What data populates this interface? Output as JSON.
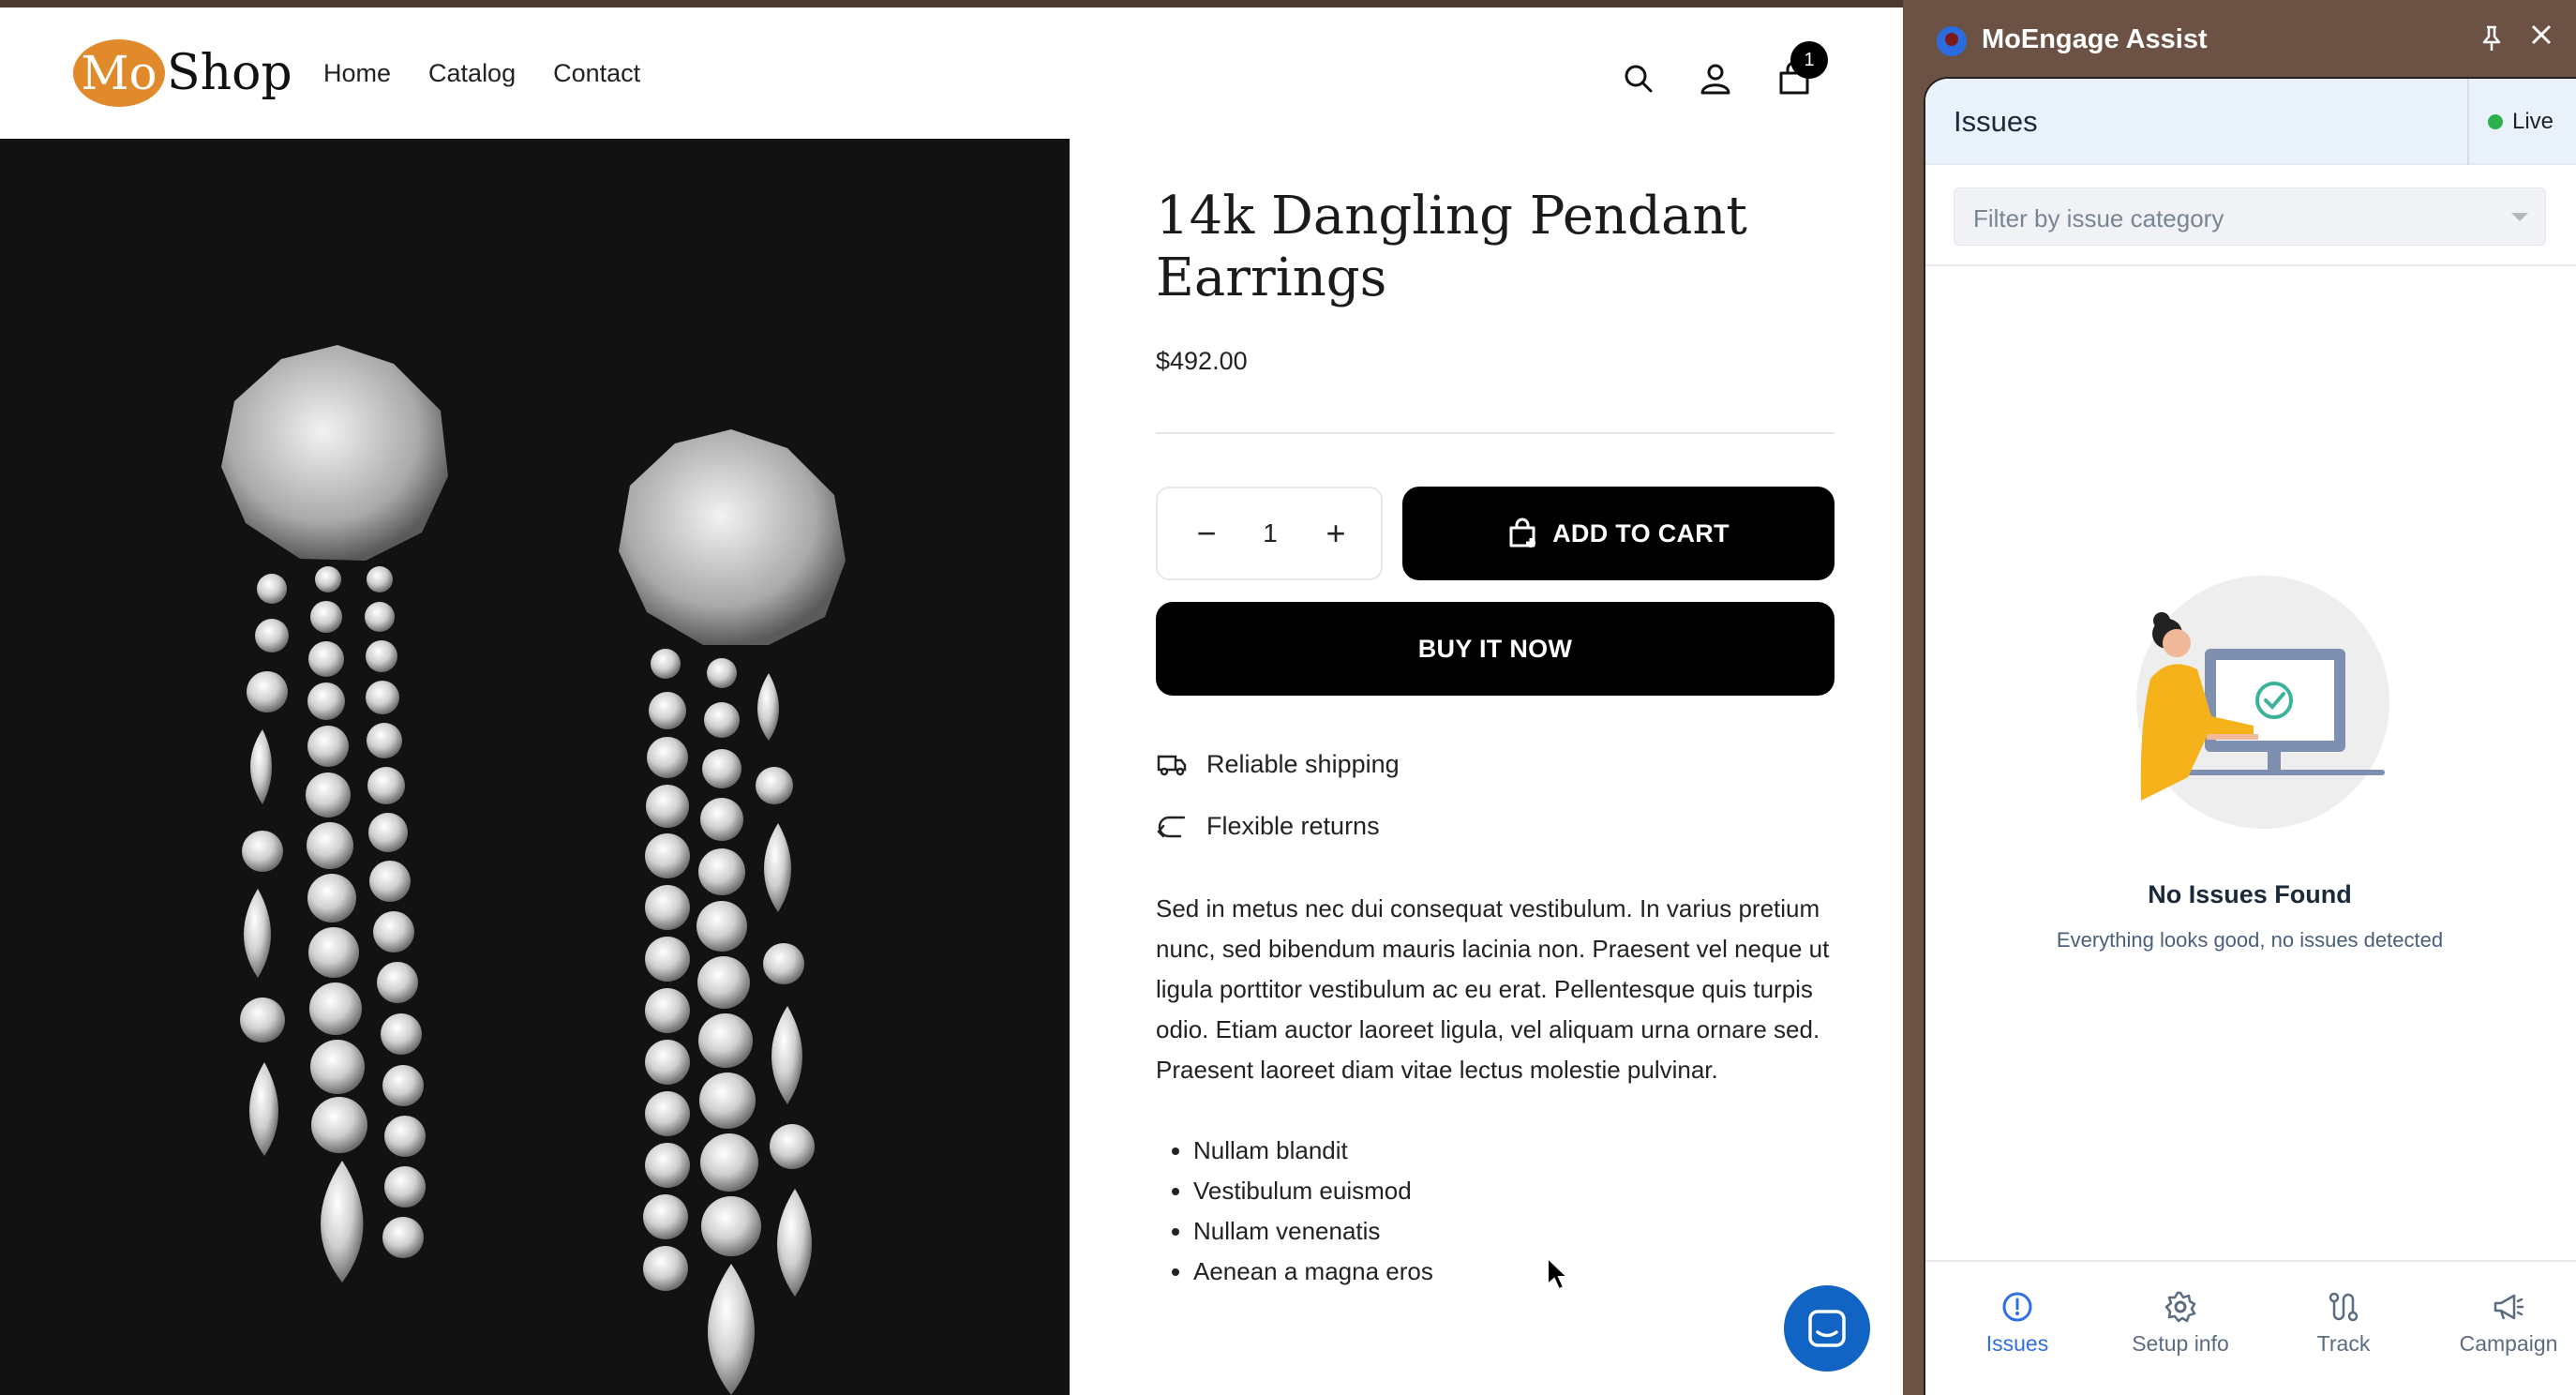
{
  "shop": {
    "logo": {
      "mo": "Mo",
      "shop": "Shop"
    },
    "nav": [
      "Home",
      "Catalog",
      "Contact"
    ],
    "cart_count": "1",
    "product": {
      "title": "14k Dangling Pendant Earrings",
      "price": "$492.00",
      "quantity": "1",
      "add_to_cart": "ADD TO CART",
      "buy_now": "BUY IT NOW",
      "features": [
        "Reliable shipping",
        "Flexible returns"
      ],
      "description": "Sed in metus nec dui consequat vestibulum. In varius pretium nunc, sed bibendum mauris lacinia non. Praesent vel neque ut ligula porttitor vestibulum ac eu erat. Pellentesque quis turpis odio. Etiam auctor laoreet ligula, vel aliquam urna ornare sed. Praesent laoreet diam vitae lectus molestie pulvinar.",
      "bullets": [
        "Nullam blandit",
        "Vestibulum euismod",
        "Nullam venenatis",
        "Aenean a magna eros"
      ]
    }
  },
  "assist": {
    "title": "MoEngage Assist",
    "section_title": "Issues",
    "live_label": "Live",
    "filter_placeholder": "Filter by issue category",
    "empty_title": "No Issues Found",
    "empty_subtitle": "Everything looks good, no issues detected",
    "tabs": [
      "Issues",
      "Setup info",
      "Track",
      "Campaign"
    ]
  },
  "colors": {
    "accent_orange": "#e08a2c",
    "panel_brown": "#6b5245",
    "primary_blue": "#2f6fe0",
    "live_green": "#2bb24c",
    "chat_blue": "#1163c4"
  }
}
